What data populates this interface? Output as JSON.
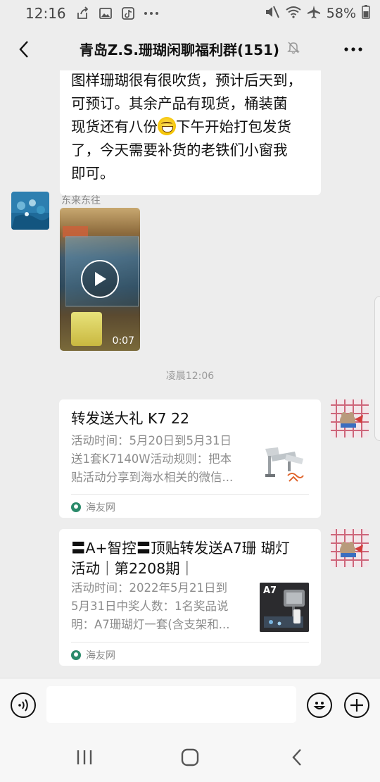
{
  "status_bar": {
    "time": "12:16",
    "battery": "58%",
    "left_icons": [
      "share-icon",
      "image-icon",
      "tiktok-icon",
      "more-dots-icon"
    ],
    "right_icons": [
      "mute-icon",
      "wifi-icon",
      "airplane-icon",
      "battery-icon"
    ]
  },
  "header": {
    "title": "青岛Z.S.珊瑚闲聊福利群(151)",
    "muted_icon": "bell-off-icon"
  },
  "messages": {
    "text_message": {
      "line1": "图样珊瑚很有很吹货，预计后天到，",
      "line2": "可预订。其余产品有现货，桶装菌",
      "line3a": "现货还有八份",
      "line3b": "下午开始打包发货",
      "line4": "了，今天需要补货的老铁们小窗我",
      "line5": "即可。"
    },
    "video_message": {
      "sender": "东来东往",
      "duration": "0:07"
    },
    "timestamp": "凌晨12:06",
    "link_card_1": {
      "title": "转发送大礼 K7 22",
      "desc_line1": "活动时间：5月20日到5月31日",
      "desc_line2": "送1套K7140W活动规则：把本",
      "desc_line3": "贴活动分享到海水相关的微信...",
      "source": "海友网"
    },
    "link_card_2": {
      "title_line1": "〓A+智控〓顶贴转发送A7珊 瑚灯",
      "title_line2": "活动｜第2208期｜",
      "desc_line1": "活动时间：2022年5月21日到",
      "desc_line2": "5月31日中奖人数：1名奖品说",
      "desc_line3": "明：A7珊瑚灯一套(含支架和...",
      "thumb_label": "A7",
      "source": "海友网"
    }
  },
  "input_bar": {
    "voice_icon": "voice-icon",
    "emoji_icon": "emoji-icon",
    "plus_icon": "plus-icon"
  },
  "colors": {
    "background": "#ededed",
    "bubble": "#ffffff",
    "meta_text": "#8a8a8a"
  }
}
